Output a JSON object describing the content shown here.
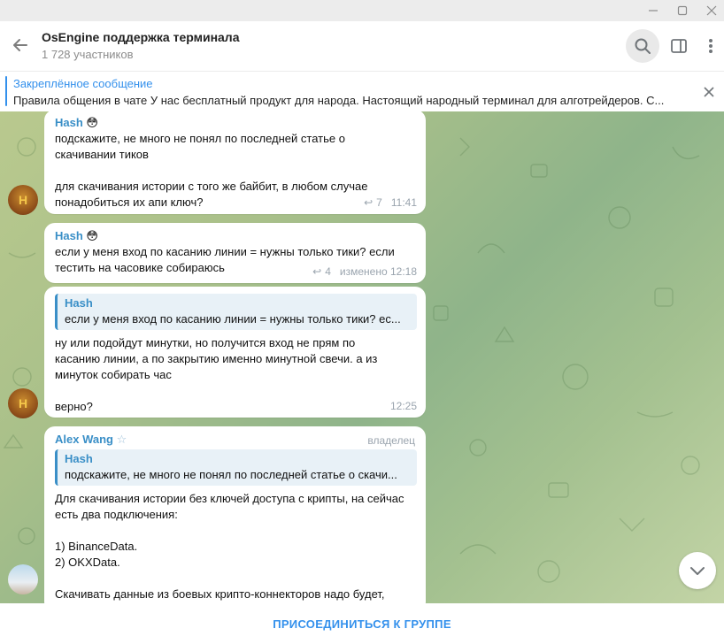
{
  "window": {
    "minimize_icon": "minimize-icon",
    "maximize_icon": "maximize-icon",
    "close_icon": "close-icon"
  },
  "header": {
    "title": "OsEngine поддержка терминала",
    "subtitle": "1 728 участников"
  },
  "pinned": {
    "title": "Закреплённое сообщение",
    "text": "Правила общения в чате  У нас бесплатный продукт для народа. Настоящий народный терминал для алготрейдеров. С..."
  },
  "messages": [
    {
      "sender": "Hash",
      "emoji": "😳",
      "text": "подскажите, не много не понял по последней статье о\nскачивании тиков\n\nдля скачивания истории с того же байбит, в любом случае\nпонадобиться их апи ключ?",
      "replies": "7",
      "time": "11:41"
    },
    {
      "sender": "Hash",
      "emoji": "😳",
      "text": "если у меня вход по касанию линии = нужны только тики? если\nтестить на часовике собираюсь",
      "replies": "4",
      "time": "изменено 12:18"
    },
    {
      "reply_name": "Hash",
      "reply_text": "если у меня вход по касанию линии = нужны только тики? ес...",
      "text": "ну или подойдут минутки, но получится вход не прям по\nкасанию линии, а по закрытию именно минутной свечи. а из\nминуток собирать час\n\nверно?",
      "time": "12:25"
    },
    {
      "sender": "Alex Wang",
      "star": "☆",
      "badge": "владелец",
      "reply_name": "Hash",
      "reply_text": "подскажите, не много не понял по последней статье о скачи...",
      "text": "Для скачивания истории без ключей доступа с крипты, на сейчас\nесть два подключения:\n\n1) BinanceData.\n2) OKXData.\n\nСкачивать данные из боевых крипто-коннекторов надо будет,"
    }
  ],
  "avatars": {
    "hash_letter": "H"
  },
  "join_label": "ПРИСОЕДИНИТЬСЯ К ГРУППЕ"
}
